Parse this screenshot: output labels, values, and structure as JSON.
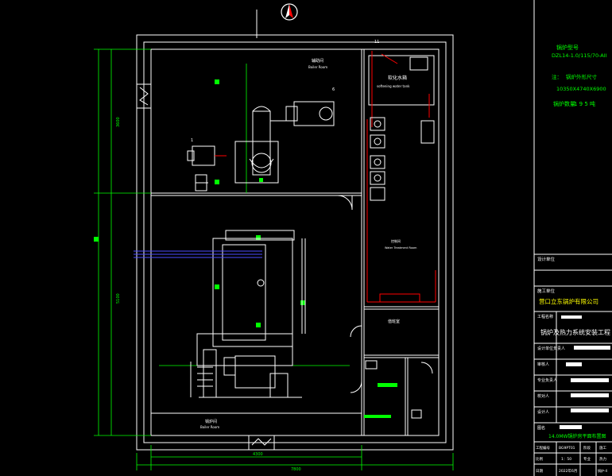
{
  "app": {
    "title": "锅炉房平面布置图",
    "background": "#000000"
  },
  "colors": {
    "wall": "#ffffff",
    "dimension": "#00ff00",
    "equipment": "#ffffff",
    "pipe_red": "#ff0000",
    "pipe_blue": "#4d4dff",
    "boiler_info_text": "#00ff00",
    "title_block_green": "#00ff00",
    "company_text": "#ffff00"
  },
  "drawing": {
    "rooms": {
      "aux_room_label": "辅助间",
      "aux_room_sub": "Boiler Room",
      "water_treatment_label": "软化水箱",
      "water_treatment_sub": "softening water tank",
      "control_room_label": "控制间",
      "boiler_room_label": "锅炉间",
      "boiler_room_sub": "Boiler Room",
      "right_mid_label": "值班室",
      "right_mid_sub": "Water Treatment Room"
    },
    "callouts": [
      "11",
      "6",
      "1"
    ],
    "dimensions": {
      "left_upper": "3600",
      "left_lower": "5100",
      "bottom_total": "7800",
      "bottom_inner": "4300"
    }
  },
  "boiler_info": {
    "model_label": "锅炉型号",
    "model_value": "DZL14-1.0/115/70-AII",
    "note_label": "注：",
    "size_label": "锅炉外形尺寸",
    "size_value": "10350X4740X6900",
    "count_label": "锅炉数量",
    "count_value": "1 9 5 吨"
  },
  "title_block": {
    "design_unit_label": "设计单位",
    "build_unit_label": "施工单位",
    "company": "营口立东锅炉有限公司",
    "project_name_label": "工程名称",
    "project_name": "锅炉及热力系统安装工程",
    "rows": [
      "设计单位负责人",
      "审核人",
      "专业负责人",
      "校对人",
      "设计人"
    ],
    "drawing_name_label": "图名",
    "drawing_name": "14.0MW锅炉房平面布置图",
    "bottom": {
      "project_no_label": "工程编号",
      "project_no": "BG9PT01",
      "stage_label": "阶段",
      "stage_value": "施工",
      "scale_label": "比例",
      "scale_value": "1：50",
      "specialty_label": "专业",
      "specialty_value": "热力",
      "date_label": "日期",
      "date_value": "2022年6月",
      "sheet_label": "锅炉-4"
    }
  }
}
